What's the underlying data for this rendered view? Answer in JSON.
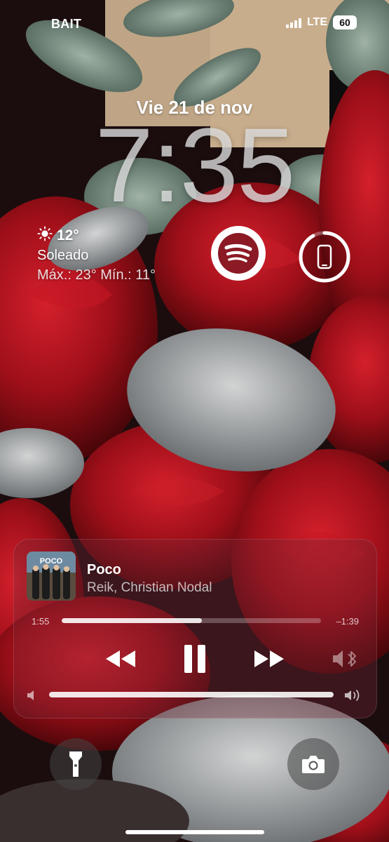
{
  "status_bar": {
    "carrier": "BAIT",
    "network": "LTE",
    "battery": "60",
    "signal_bars": 4
  },
  "lock_screen": {
    "date": "Vie 21 de nov",
    "time": "7:35"
  },
  "weather": {
    "icon": "sun-icon",
    "temperature": "12°",
    "condition": "Soleado",
    "range": "Máx.: 23° Mín.: 11°"
  },
  "widgets": {
    "spotify": {
      "icon": "spotify-icon",
      "color": "#8b1a24"
    },
    "phone_battery": {
      "icon": "phone-icon",
      "level": 0.92
    }
  },
  "now_playing": {
    "title": "Poco",
    "artist": "Reik, Christian Nodal",
    "album_art_text": "POCO",
    "elapsed": "1:55",
    "remaining": "–1:39",
    "progress": 0.54,
    "volume": 1.0,
    "controls": {
      "back_icon": "rewind-icon",
      "pause_icon": "pause-icon",
      "forward_icon": "fast-forward-icon",
      "audio_output_icon": "speaker-bluetooth-icon"
    }
  },
  "quick_actions": {
    "flashlight_icon": "flashlight-icon",
    "camera_icon": "camera-icon"
  },
  "colors": {
    "rose_red": "#b3101c",
    "rose_dark": "#5c0a10",
    "leaf_gray": "#a9acae",
    "background": "#1a0a0c"
  }
}
